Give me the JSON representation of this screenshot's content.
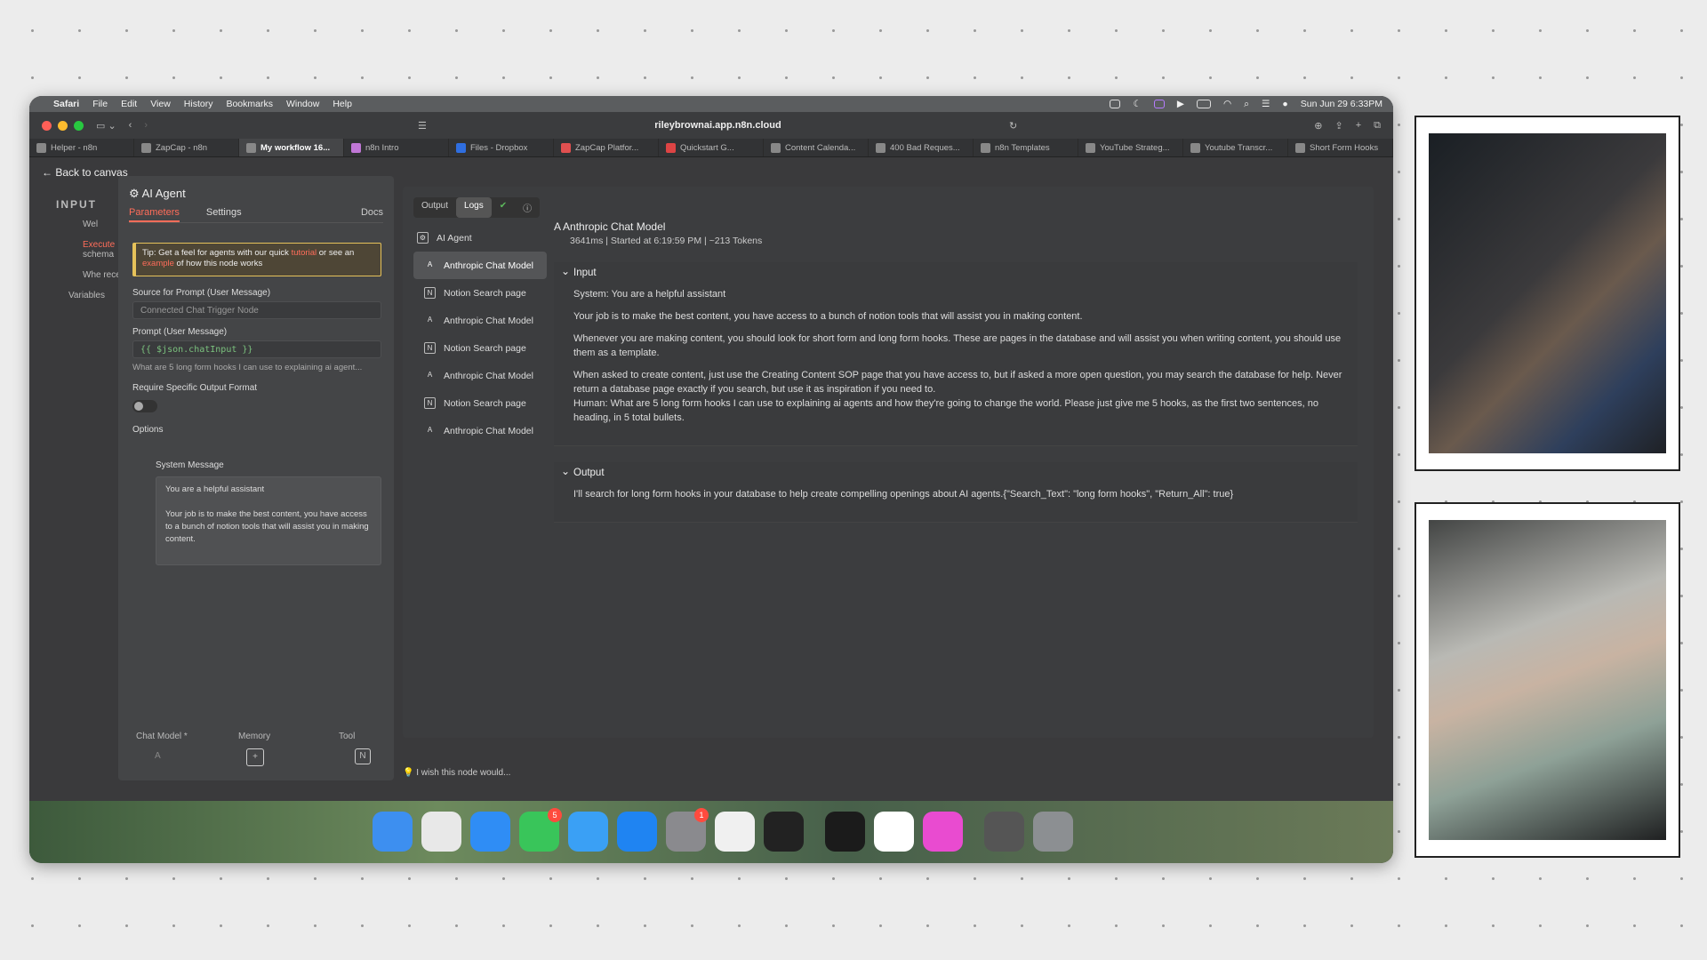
{
  "menubar": {
    "app": "Safari",
    "items": [
      "File",
      "Edit",
      "View",
      "History",
      "Bookmarks",
      "Window",
      "Help"
    ],
    "clock": "Sun Jun 29  6:33PM"
  },
  "toolbar": {
    "url": "rileybrownai.app.n8n.cloud"
  },
  "tabs": [
    {
      "label": "Helper - n8n"
    },
    {
      "label": "ZapCap - n8n"
    },
    {
      "label": "My workflow 16..."
    },
    {
      "label": "n8n Intro"
    },
    {
      "label": "Files - Dropbox"
    },
    {
      "label": "ZapCap Platfor..."
    },
    {
      "label": "Quickstart G..."
    },
    {
      "label": "Content Calenda..."
    },
    {
      "label": "400 Bad Reques..."
    },
    {
      "label": "n8n Templates"
    },
    {
      "label": "YouTube Strateg..."
    },
    {
      "label": "Youtube Transcr..."
    },
    {
      "label": "Short Form Hooks"
    }
  ],
  "canvas": {
    "back_label": "Back to canvas",
    "input_label": "INPUT",
    "tree": [
      "Wel",
      "Execute",
      "schema",
      "Whe rece",
      "Variables"
    ]
  },
  "params": {
    "title": "AI Agent",
    "tab_parameters": "Parameters",
    "tab_settings": "Settings",
    "docs": "Docs",
    "tip_pre": "Tip: Get a feel for agents with our quick ",
    "tip_link1": "tutorial",
    "tip_mid": " or see an ",
    "tip_link2": "example",
    "tip_post": " of how this node works",
    "source_label": "Source for Prompt (User Message)",
    "source_value": "Connected Chat Trigger Node",
    "prompt_label": "Prompt (User Message)",
    "prompt_value": "{{ $json.chatInput }}",
    "prompt_preview": "What are 5 long form hooks I can use to explaining ai agent...",
    "require_label": "Require Specific Output Format",
    "options_label": "Options",
    "sysmsg_label": "System Message",
    "sysmsg_line1": "You are a helpful assistant",
    "sysmsg_line2": "Your job is to make the best content, you have access to a bunch of notion tools that will assist you in making content.",
    "chat_model": "Chat Model *",
    "memory": "Memory",
    "tool": "Tool"
  },
  "logs": {
    "tab_output": "Output",
    "tab_logs": "Logs",
    "steps": [
      {
        "label": "AI Agent"
      },
      {
        "label": "Anthropic Chat Model"
      },
      {
        "label": "Notion Search page"
      },
      {
        "label": "Anthropic Chat Model"
      },
      {
        "label": "Notion Search page"
      },
      {
        "label": "Anthropic Chat Model"
      },
      {
        "label": "Notion Search page"
      },
      {
        "label": "Anthropic Chat Model"
      }
    ],
    "detail_title": "Anthropic Chat Model",
    "detail_meta": "3641ms  |  Started at 6:19:59 PM  |    ~213 Tokens",
    "input_header": "Input",
    "input_p1": "System: You are a helpful assistant",
    "input_p2": "Your job is to make the best content, you have access to a bunch of notion tools that will assist you in making content.",
    "input_p3": "Whenever you are making content, you should look for short form and long form hooks. These are pages in the database and will assist you when writing content, you should use them as a template.",
    "input_p4": "When asked to create content, just use the Creating Content SOP page that you have access to, but if asked a more open question, you may search the database for help. Never return a database page exactly if you search, but use it as inspiration if you need to.",
    "input_p5": "Human: What are 5 long form hooks I can use to explaining ai agents and how they're going to change the world. Please just give me 5 hooks, as the first two sentences, no heading, in 5 total bullets.",
    "output_header": "Output",
    "output_p1": "I'll search for long form hooks in your database to help create compelling openings about AI agents.{\"Search_Text\": \"long form hooks\", \"Return_All\": true}",
    "wish": "I wish this node would..."
  },
  "dock": {
    "messages_badge": "5",
    "settings_badge": "1"
  }
}
